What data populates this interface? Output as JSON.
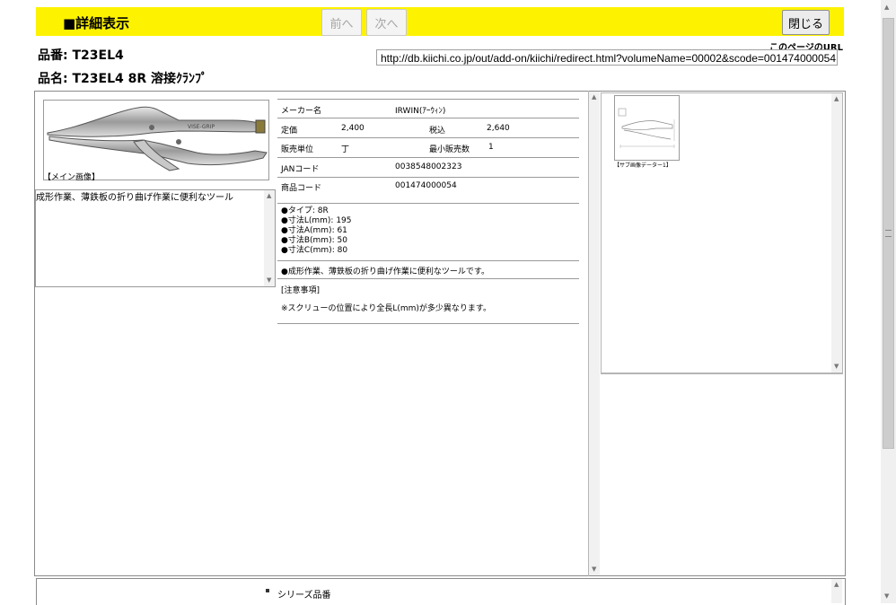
{
  "header": {
    "title": "■詳細表示",
    "prev_label": "前へ",
    "next_label": "次へ",
    "close_label": "閉じる"
  },
  "product": {
    "part_no": "品番: T23EL4",
    "part_name": "品名: T23EL4 8R 溶接ｸﾗﾝﾌﾟ"
  },
  "url": {
    "label": "このページのURL",
    "value": "http://db.kiichi.co.jp/out/add-on/kiichi/redirect.html?volumeName=00002&scode=001474000054"
  },
  "main_image": {
    "label": "【メイン画像】",
    "icon": "locking-pliers-image"
  },
  "description_box": "成形作業、薄鉄板の折り曲げ作業に便利なツール",
  "specs": {
    "maker_label": "メーカー名",
    "maker_value": "IRWIN(ｱｰｳｨﾝ)",
    "list_price_label": "定価",
    "list_price_value": "2,400",
    "tax_incl_label": "税込",
    "tax_incl_value": "2,640",
    "unit_label": "販売単位",
    "unit_value": "丁",
    "min_qty_label": "最小販売数",
    "min_qty_value": "1",
    "jan_label": "JANコード",
    "jan_value": "0038548002323",
    "product_code_label": "商品コード",
    "product_code_value": "001474000054",
    "bullets": [
      "●タイプ: 8R",
      "●寸法L(mm): 195",
      "●寸法A(mm): 61",
      "●寸法B(mm): 50",
      "●寸法C(mm): 80"
    ],
    "feature": "●成形作業、薄鉄板の折り曲げ作業に便利なツールです。",
    "caution_heading": "[注意事項]",
    "caution_text": "※スクリューの位置により全長L(mm)が多少異なります。"
  },
  "thumbnail": {
    "label": "【サブ画像データー1】",
    "icon": "dimension-drawing-image"
  },
  "bottom": {
    "series_label": "シリーズ品番"
  }
}
